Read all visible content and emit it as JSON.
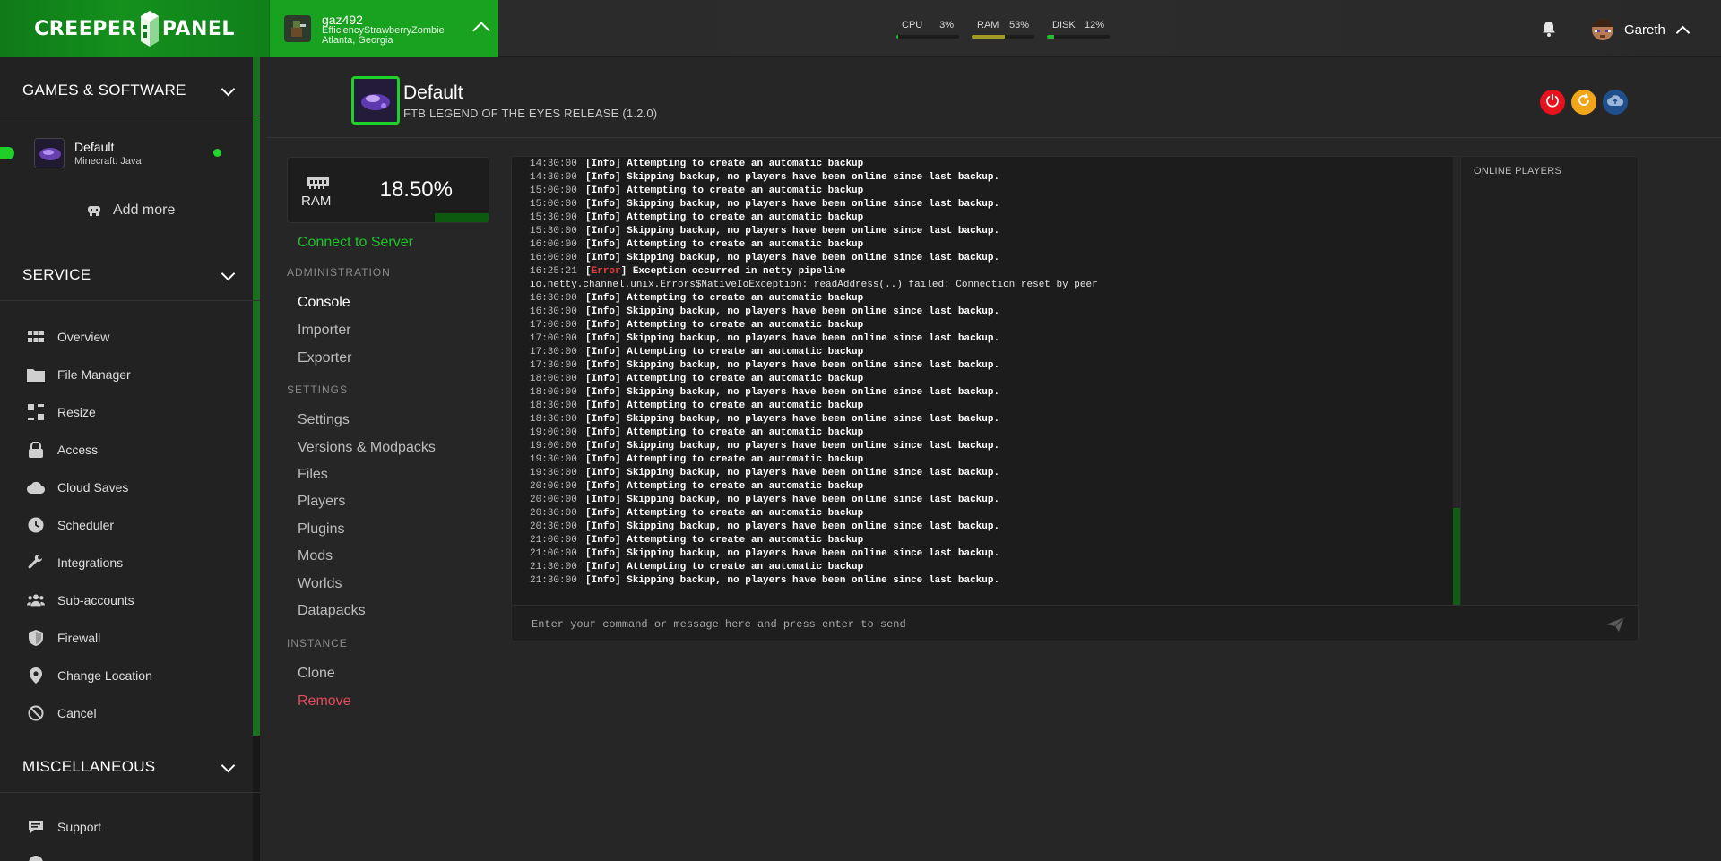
{
  "brand": {
    "left": "CREEPER",
    "right": "PANEL"
  },
  "server": {
    "username": "gaz492",
    "name": "EfficiencyStrawberryZombie",
    "location": "Atlanta, Georgia"
  },
  "stats": [
    {
      "label": "CPU",
      "value": "3%",
      "fraction": 0.03,
      "color": "#1fbf2a"
    },
    {
      "label": "RAM",
      "value": "53%",
      "fraction": 0.53,
      "color": "#a19a24"
    },
    {
      "label": "DISK",
      "value": "12%",
      "fraction": 0.12,
      "color": "#1fbf2a"
    }
  ],
  "user": {
    "name": "Gareth"
  },
  "sidebar": {
    "sections": {
      "games": "GAMES & SOFTWARE",
      "service": "SERVICE",
      "misc": "MISCELLANEOUS"
    },
    "game": {
      "name": "Default",
      "type": "Minecraft: Java"
    },
    "add_more": "Add more",
    "service_items": [
      {
        "label": "Overview",
        "icon": "grid-icon"
      },
      {
        "label": "File Manager",
        "icon": "folder-icon"
      },
      {
        "label": "Resize",
        "icon": "resize-icon"
      },
      {
        "label": "Access",
        "icon": "lock-icon"
      },
      {
        "label": "Cloud Saves",
        "icon": "cloud-icon"
      },
      {
        "label": "Scheduler",
        "icon": "clock-icon"
      },
      {
        "label": "Integrations",
        "icon": "wrench-icon"
      },
      {
        "label": "Sub-accounts",
        "icon": "users-icon"
      },
      {
        "label": "Firewall",
        "icon": "shield-icon"
      },
      {
        "label": "Change Location",
        "icon": "map-pin-icon"
      },
      {
        "label": "Cancel",
        "icon": "ban-icon"
      }
    ],
    "misc_items": [
      {
        "label": "Support",
        "icon": "chat-icon"
      }
    ]
  },
  "instance": {
    "title": "Default",
    "subtitle": "FTB LEGEND OF THE EYES RELEASE (1.2.0)"
  },
  "ram_card": {
    "label": "RAM",
    "value": "18.50%"
  },
  "connect_label": "Connect to Server",
  "admin": {
    "heading": "ADMINISTRATION",
    "items": [
      "Console",
      "Importer",
      "Exporter"
    ]
  },
  "settings": {
    "heading": "SETTINGS",
    "items": [
      "Settings",
      "Versions & Modpacks",
      "Files",
      "Players",
      "Plugins",
      "Mods",
      "Worlds",
      "Datapacks"
    ]
  },
  "instance_menu": {
    "heading": "INSTANCE",
    "items": [
      "Clone",
      "Remove"
    ]
  },
  "console": {
    "online_players_heading": "ONLINE PLAYERS",
    "command_placeholder": "Enter your command or message here and press enter to send",
    "lines": [
      {
        "t": "14:30:00",
        "level": "Info",
        "msg": "Attempting to create an automatic backup"
      },
      {
        "t": "14:30:00",
        "level": "Info",
        "msg": "Skipping backup, no players have been online since last backup."
      },
      {
        "t": "15:00:00",
        "level": "Info",
        "msg": "Attempting to create an automatic backup"
      },
      {
        "t": "15:00:00",
        "level": "Info",
        "msg": "Skipping backup, no players have been online since last backup."
      },
      {
        "t": "15:30:00",
        "level": "Info",
        "msg": "Attempting to create an automatic backup"
      },
      {
        "t": "15:30:00",
        "level": "Info",
        "msg": "Skipping backup, no players have been online since last backup."
      },
      {
        "t": "16:00:00",
        "level": "Info",
        "msg": "Attempting to create an automatic backup"
      },
      {
        "t": "16:00:00",
        "level": "Info",
        "msg": "Skipping backup, no players have been online since last backup."
      },
      {
        "t": "16:25:21",
        "level": "Error",
        "msg": "Exception occurred in netty pipeline"
      },
      {
        "t": "",
        "level": "",
        "msg": "io.netty.channel.unix.Errors$NativeIoException: readAddress(..) failed: Connection reset by peer"
      },
      {
        "t": "16:30:00",
        "level": "Info",
        "msg": "Attempting to create an automatic backup"
      },
      {
        "t": "16:30:00",
        "level": "Info",
        "msg": "Skipping backup, no players have been online since last backup."
      },
      {
        "t": "17:00:00",
        "level": "Info",
        "msg": "Attempting to create an automatic backup"
      },
      {
        "t": "17:00:00",
        "level": "Info",
        "msg": "Skipping backup, no players have been online since last backup."
      },
      {
        "t": "17:30:00",
        "level": "Info",
        "msg": "Attempting to create an automatic backup"
      },
      {
        "t": "17:30:00",
        "level": "Info",
        "msg": "Skipping backup, no players have been online since last backup."
      },
      {
        "t": "18:00:00",
        "level": "Info",
        "msg": "Attempting to create an automatic backup"
      },
      {
        "t": "18:00:00",
        "level": "Info",
        "msg": "Skipping backup, no players have been online since last backup."
      },
      {
        "t": "18:30:00",
        "level": "Info",
        "msg": "Attempting to create an automatic backup"
      },
      {
        "t": "18:30:00",
        "level": "Info",
        "msg": "Skipping backup, no players have been online since last backup."
      },
      {
        "t": "19:00:00",
        "level": "Info",
        "msg": "Attempting to create an automatic backup"
      },
      {
        "t": "19:00:00",
        "level": "Info",
        "msg": "Skipping backup, no players have been online since last backup."
      },
      {
        "t": "19:30:00",
        "level": "Info",
        "msg": "Attempting to create an automatic backup"
      },
      {
        "t": "19:30:00",
        "level": "Info",
        "msg": "Skipping backup, no players have been online since last backup."
      },
      {
        "t": "20:00:00",
        "level": "Info",
        "msg": "Attempting to create an automatic backup"
      },
      {
        "t": "20:00:00",
        "level": "Info",
        "msg": "Skipping backup, no players have been online since last backup."
      },
      {
        "t": "20:30:00",
        "level": "Info",
        "msg": "Attempting to create an automatic backup"
      },
      {
        "t": "20:30:00",
        "level": "Info",
        "msg": "Skipping backup, no players have been online since last backup."
      },
      {
        "t": "21:00:00",
        "level": "Info",
        "msg": "Attempting to create an automatic backup"
      },
      {
        "t": "21:00:00",
        "level": "Info",
        "msg": "Skipping backup, no players have been online since last backup."
      },
      {
        "t": "21:30:00",
        "level": "Info",
        "msg": "Attempting to create an automatic backup"
      },
      {
        "t": "21:30:00",
        "level": "Info",
        "msg": "Skipping backup, no players have been online since last backup."
      }
    ]
  },
  "colors": {
    "accent": "#1fcf29",
    "brand_green": "#14901d",
    "danger": "#e44b5c",
    "power": "#e8121d",
    "restart": "#f0a51a",
    "backup": "#1f4f8c"
  }
}
